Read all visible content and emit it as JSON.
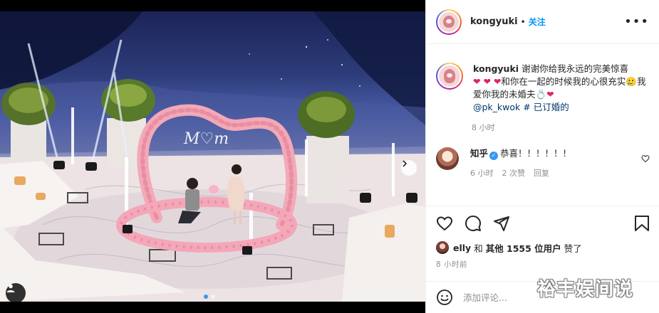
{
  "post": {
    "username": "kongyuki",
    "separator": "•",
    "follow_label": "关注",
    "more_label": "•••",
    "caption": {
      "username": "kongyuki",
      "text_1": "谢谢你给我永远的完美惊喜",
      "hearts": "❤ ❤ ❤",
      "text_2": "和你在一起的时候我的心很充实",
      "emoji_face": "🥲",
      "text_3": "我爱你我的未婚夫",
      "emoji_ring": "💍",
      "heart_end": "❤",
      "mention": "@pk_kwok",
      "hashtag": "# 已订婚的"
    },
    "caption_time": "8 小时"
  },
  "comment": {
    "username": "知乎",
    "verified_mark": "✓",
    "text": "恭喜！！！！！！",
    "time": "6 小时",
    "likes": "2 次赞",
    "reply_label": "回复"
  },
  "likes_summary": {
    "user": "elly",
    "joiner": "和",
    "others": "其他 1555 位用户",
    "suffix": "赞了"
  },
  "post_time": "8 小时前",
  "add_comment": {
    "placeholder": "添加评论..."
  },
  "watermark": "裕丰娱间说",
  "icons": {
    "like": "heart-icon",
    "comment": "comment-icon",
    "share": "share-icon",
    "save": "bookmark-icon",
    "emoji": "emoji-icon",
    "more": "more-icon",
    "next": "chevron-right-icon",
    "tag": "user-tag-icon"
  },
  "colors": {
    "accent": "#0095f6",
    "heart": "#e0245e",
    "mention": "#00376b",
    "muted": "#8e8e8e"
  }
}
